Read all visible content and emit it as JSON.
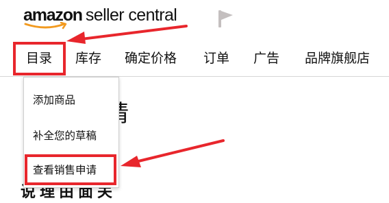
{
  "header": {
    "logo_amazon": "amazon",
    "logo_rest": "seller central",
    "flag_icon": "flag-icon"
  },
  "nav": {
    "items": [
      {
        "label": "目录"
      },
      {
        "label": "库存"
      },
      {
        "label": "确定价格"
      },
      {
        "label": "订单"
      },
      {
        "label": "广告"
      },
      {
        "label": "品牌旗舰店"
      }
    ]
  },
  "catalog_menu": {
    "items": [
      {
        "label": "添加商品"
      },
      {
        "label": "补全您的草稿"
      },
      {
        "label": "查看销售申请"
      }
    ]
  },
  "page": {
    "heading_partial": "请",
    "subheading_partial": "说理由面关"
  },
  "annotations": {
    "highlight_color": "#e8262c"
  }
}
